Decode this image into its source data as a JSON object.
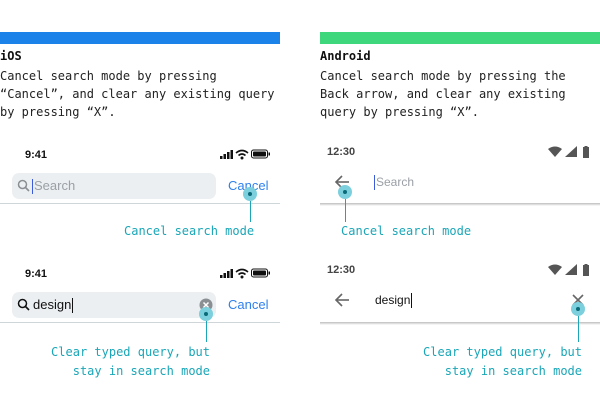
{
  "colors": {
    "ios_bar": "#1a82e8",
    "android_bar": "#3fd77b",
    "callout": "#1aa6b7",
    "ios_accent": "#2f80ed"
  },
  "ios": {
    "heading": "iOS",
    "description": "Cancel search mode by pressing\n“Cancel”, and clear any existing query\nby pressing “X”.",
    "screen1": {
      "time": "9:41",
      "search_placeholder": "Search",
      "cancel_label": "Cancel"
    },
    "screen2": {
      "time": "9:41",
      "query": "design",
      "cancel_label": "Cancel"
    },
    "callout1": "Cancel search mode",
    "callout2": "Clear typed query, but\nstay in search mode"
  },
  "android": {
    "heading": "Android",
    "description": "Cancel search mode by pressing the\nBack arrow, and clear any existing\nquery by pressing “X”.",
    "screen1": {
      "time": "12:30",
      "search_placeholder": "Search"
    },
    "screen2": {
      "time": "12:30",
      "query": "design"
    },
    "callout1": "Cancel search mode",
    "callout2": "Clear typed query, but\nstay in search mode"
  },
  "icons": [
    "search-icon",
    "signal-icon",
    "wifi-icon",
    "battery-icon",
    "clear-icon",
    "back-arrow-icon",
    "close-icon"
  ]
}
